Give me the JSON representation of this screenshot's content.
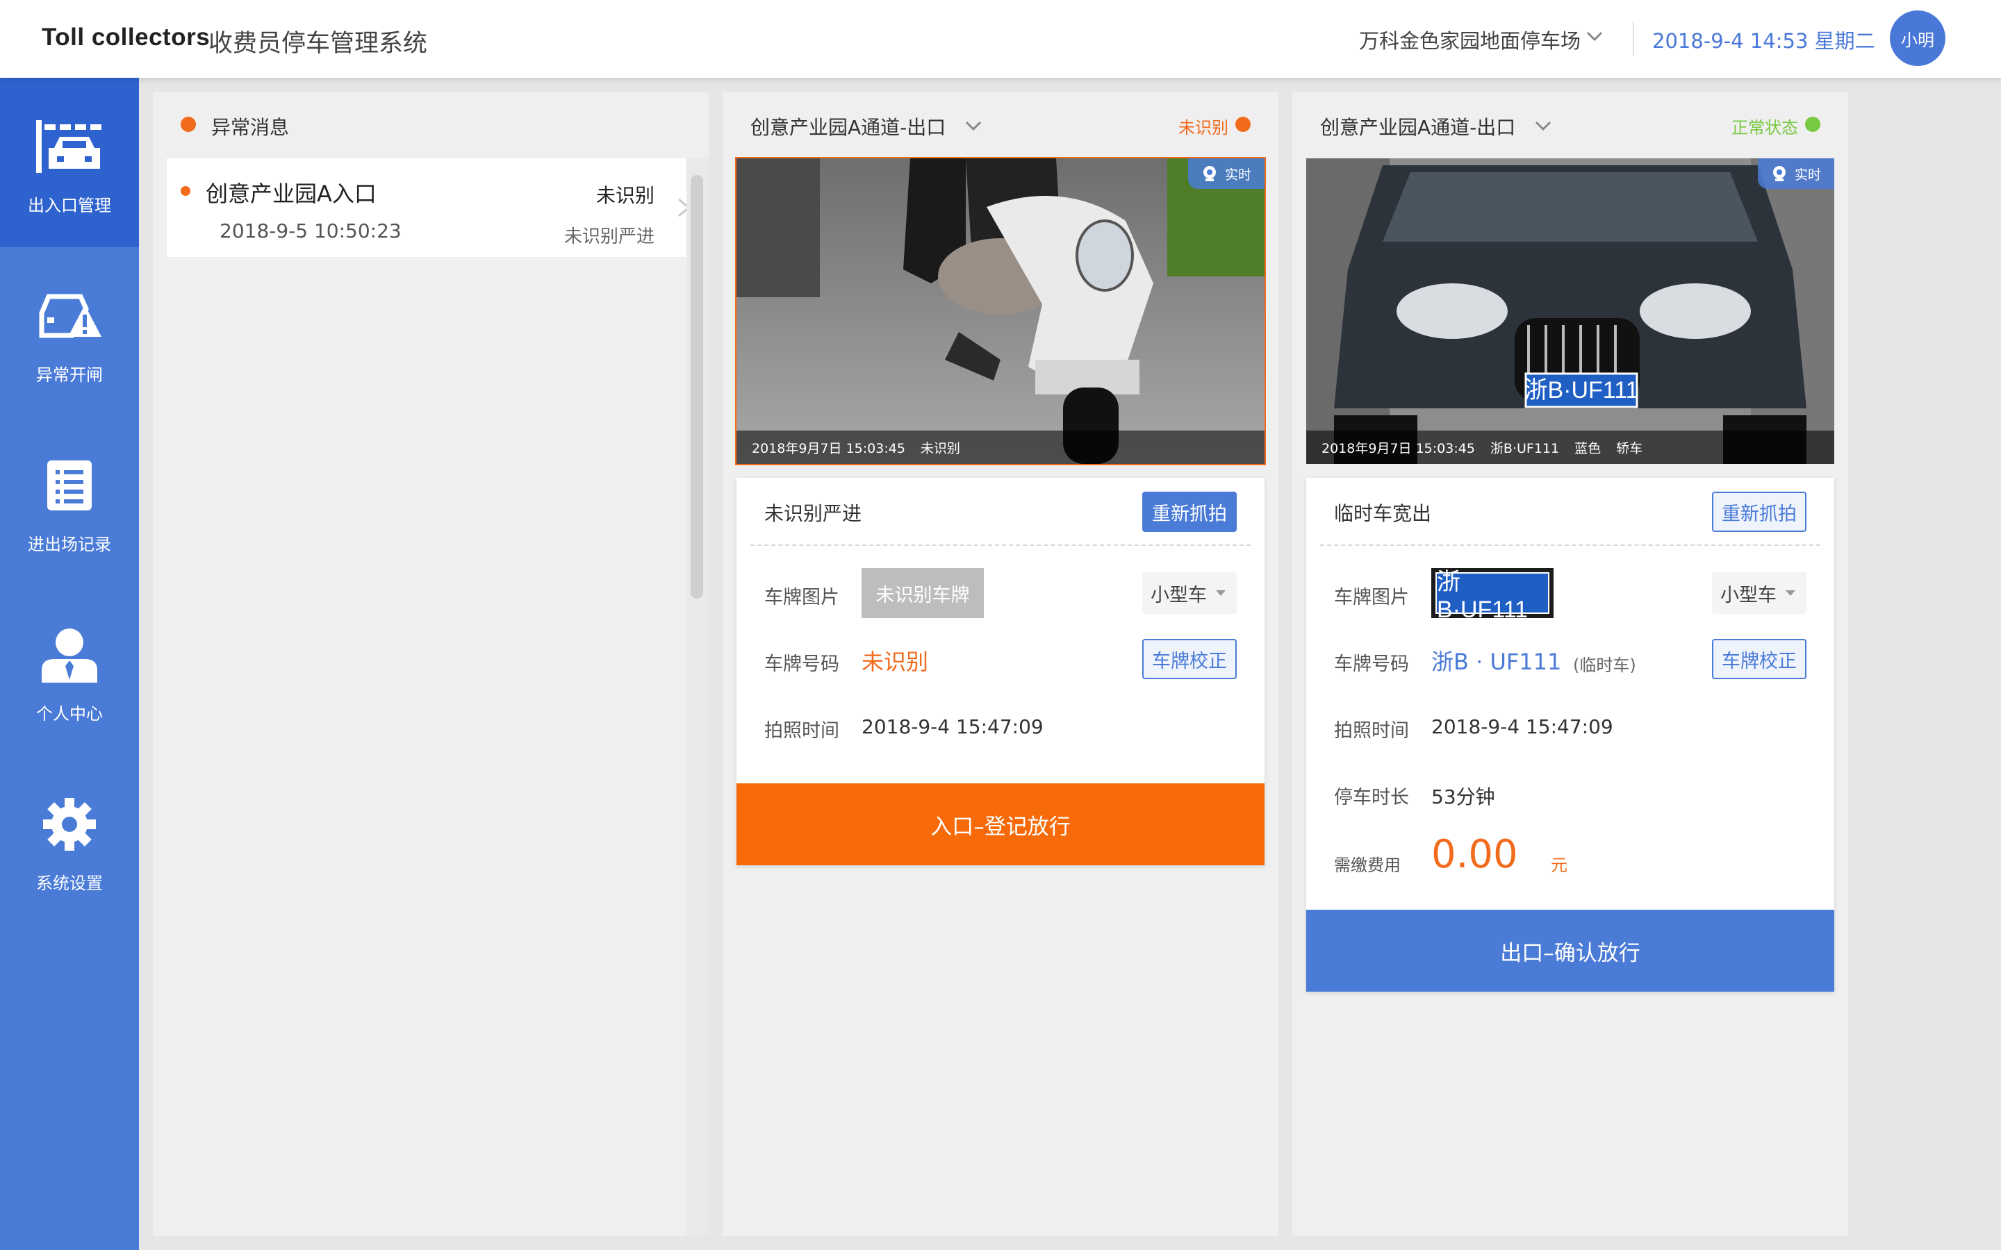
{
  "header": {
    "brand": "Toll collectors",
    "system_title": "收费员停车管理系统",
    "parking_lot": "万科金色家园地面停车场",
    "datetime": "2018-9-4 14:53 星期二",
    "user": "小明"
  },
  "sidebar": {
    "items": [
      {
        "label": "出入口管理",
        "icon": "gate-car-icon",
        "active": true
      },
      {
        "label": "异常开闸",
        "icon": "car-warning-icon"
      },
      {
        "label": "进出场记录",
        "icon": "record-list-icon"
      },
      {
        "label": "个人中心",
        "icon": "user-icon"
      },
      {
        "label": "系统设置",
        "icon": "gear-icon"
      }
    ]
  },
  "messages": {
    "title": "异常消息",
    "items": [
      {
        "title": "创意产业园A入口",
        "time": "2018-9-5 10:50:23",
        "status": "未识别",
        "sub": "未识别严进"
      }
    ]
  },
  "lanes": [
    {
      "title": "创意产业园A通道-出口",
      "status": "未识别",
      "status_color": "#f26b1d",
      "live_label": "实时",
      "caption": [
        "2018年9月7日 15:03:45",
        "未识别"
      ],
      "card_title": "未识别严进",
      "recapture": "重新抓拍",
      "plate_image_label": "车牌图片",
      "plate_placeholder": "未识别车牌",
      "vehicle_type": "小型车",
      "plate_number_label": "车牌号码",
      "plate_number": "未识别",
      "correct_plate": "车牌校正",
      "capture_time_label": "拍照时间",
      "capture_time": "2018-9-4 15:47:09",
      "action": "入口–登记放行",
      "action_color": "#f66a0a"
    },
    {
      "title": "创意产业园A通道-出口",
      "status": "正常状态",
      "status_color": "#7ac943",
      "live_label": "实时",
      "caption": [
        "2018年9月7日 15:03:45",
        "浙B·UF111",
        "蓝色",
        "轿车"
      ],
      "card_title": "临时车宽出",
      "recapture": "重新抓拍",
      "plate_image_label": "车牌图片",
      "plate_image_text": "浙B·UF111",
      "vehicle_type": "小型车",
      "plate_number_label": "车牌号码",
      "plate_number": "浙B · UF111",
      "plate_tag": "(临时车)",
      "correct_plate": "车牌校正",
      "capture_time_label": "拍照时间",
      "capture_time": "2018-9-4 15:47:09",
      "duration_label": "停车时长",
      "duration": "53分钟",
      "fee_label": "需缴费用",
      "fee": "0.00",
      "fee_unit": "元",
      "action": "出口–确认放行",
      "action_color": "#4a7bd7"
    }
  ]
}
